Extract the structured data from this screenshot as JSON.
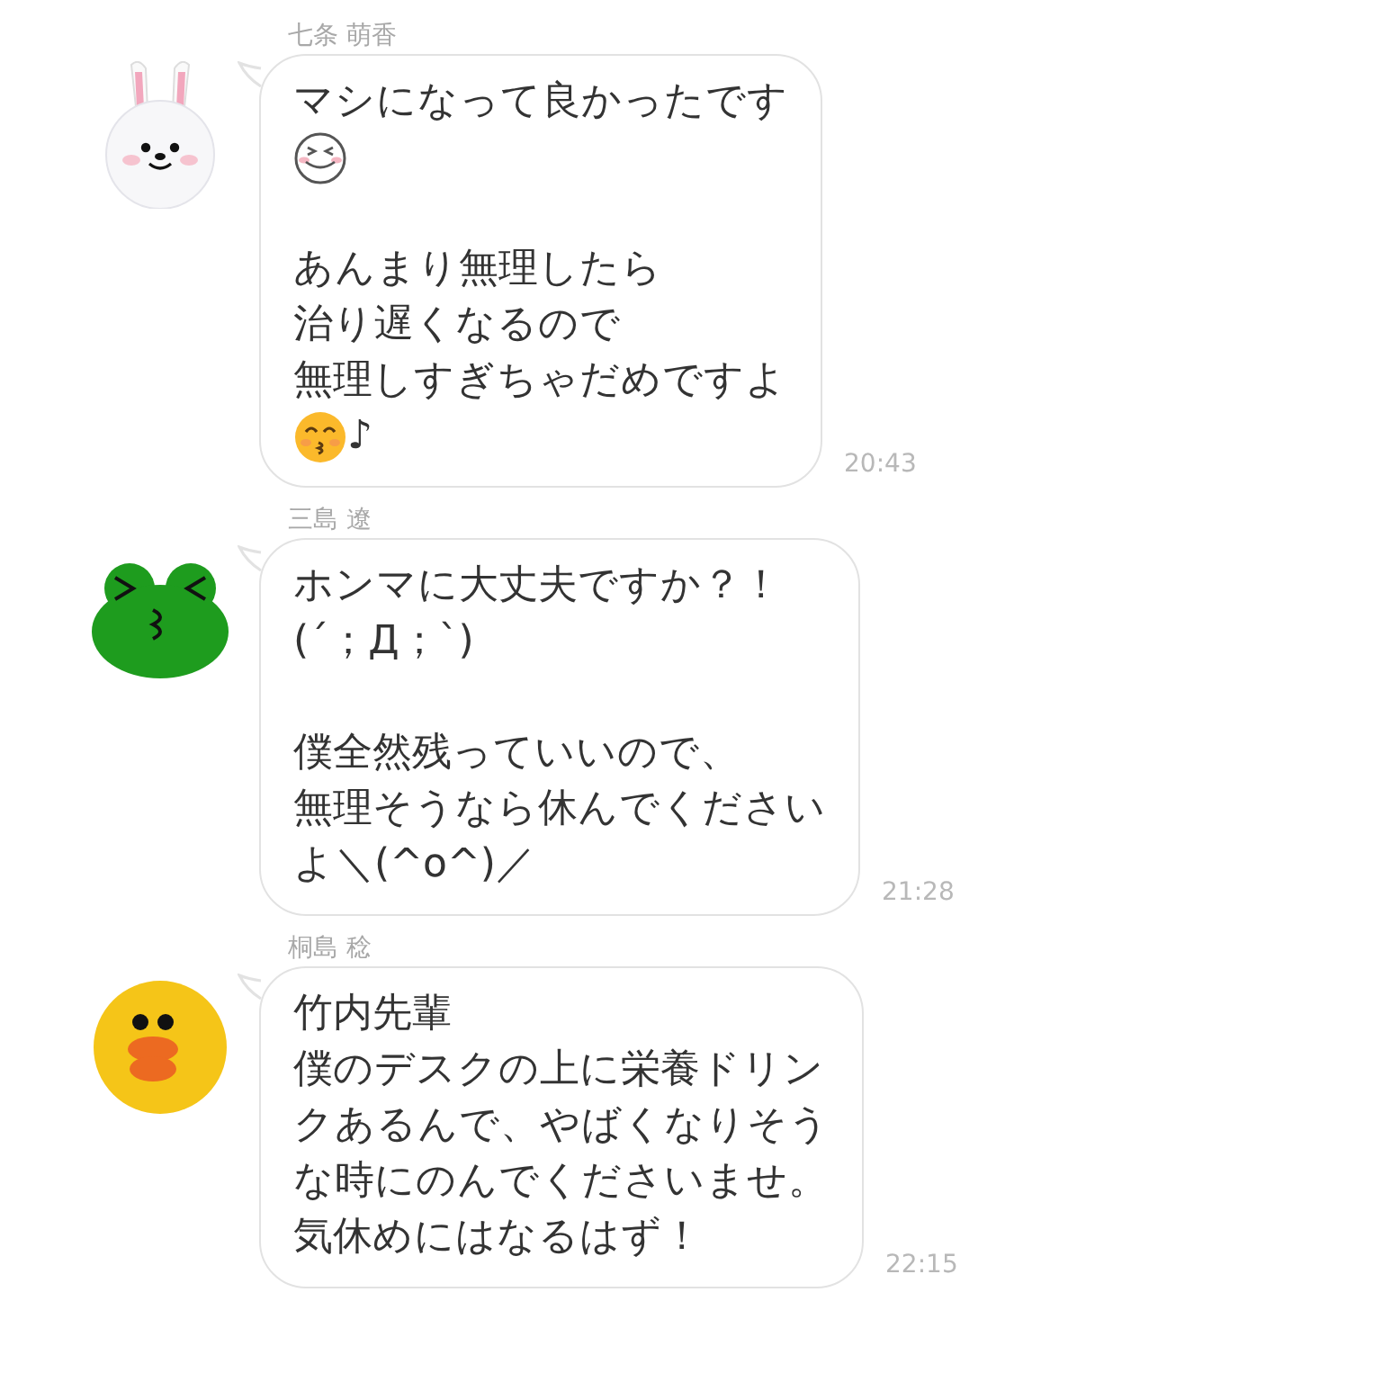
{
  "messages": [
    {
      "sender": "七条 萌香",
      "avatar": {
        "kind": "rabbit"
      },
      "time": "20:43",
      "lines": [
        {
          "kind": "text",
          "text": "マシになって良かったです"
        },
        {
          "kind": "emoticon"
        },
        {
          "kind": "gap"
        },
        {
          "kind": "text",
          "text": "あんまり無理したら"
        },
        {
          "kind": "text",
          "text": "治り遅くなるので"
        },
        {
          "kind": "text",
          "text": "無理しすぎちゃだめですよ"
        },
        {
          "kind": "emoji_text",
          "text": "♪"
        }
      ]
    },
    {
      "sender": "三島 遼",
      "avatar": {
        "kind": "frog"
      },
      "time": "21:28",
      "lines": [
        {
          "kind": "text",
          "text": "ホンマに大丈夫ですか？！"
        },
        {
          "kind": "text",
          "text": "(´；Д；`)"
        },
        {
          "kind": "gap"
        },
        {
          "kind": "text",
          "text": "僕全然残っていいので、"
        },
        {
          "kind": "text",
          "text": "無理そうなら休んでください"
        },
        {
          "kind": "text",
          "text": "よ＼(^o^)／"
        }
      ]
    },
    {
      "sender": "桐島 稔",
      "avatar": {
        "kind": "duck"
      },
      "time": "22:15",
      "lines": [
        {
          "kind": "text",
          "text": "竹内先輩"
        },
        {
          "kind": "text",
          "text": "僕のデスクの上に栄養ドリン"
        },
        {
          "kind": "text",
          "text": "クあるんで、やばくなりそう"
        },
        {
          "kind": "text",
          "text": "な時にのんでくださいませ。"
        },
        {
          "kind": "text",
          "text": "気休めにはなるはず！"
        }
      ]
    }
  ]
}
